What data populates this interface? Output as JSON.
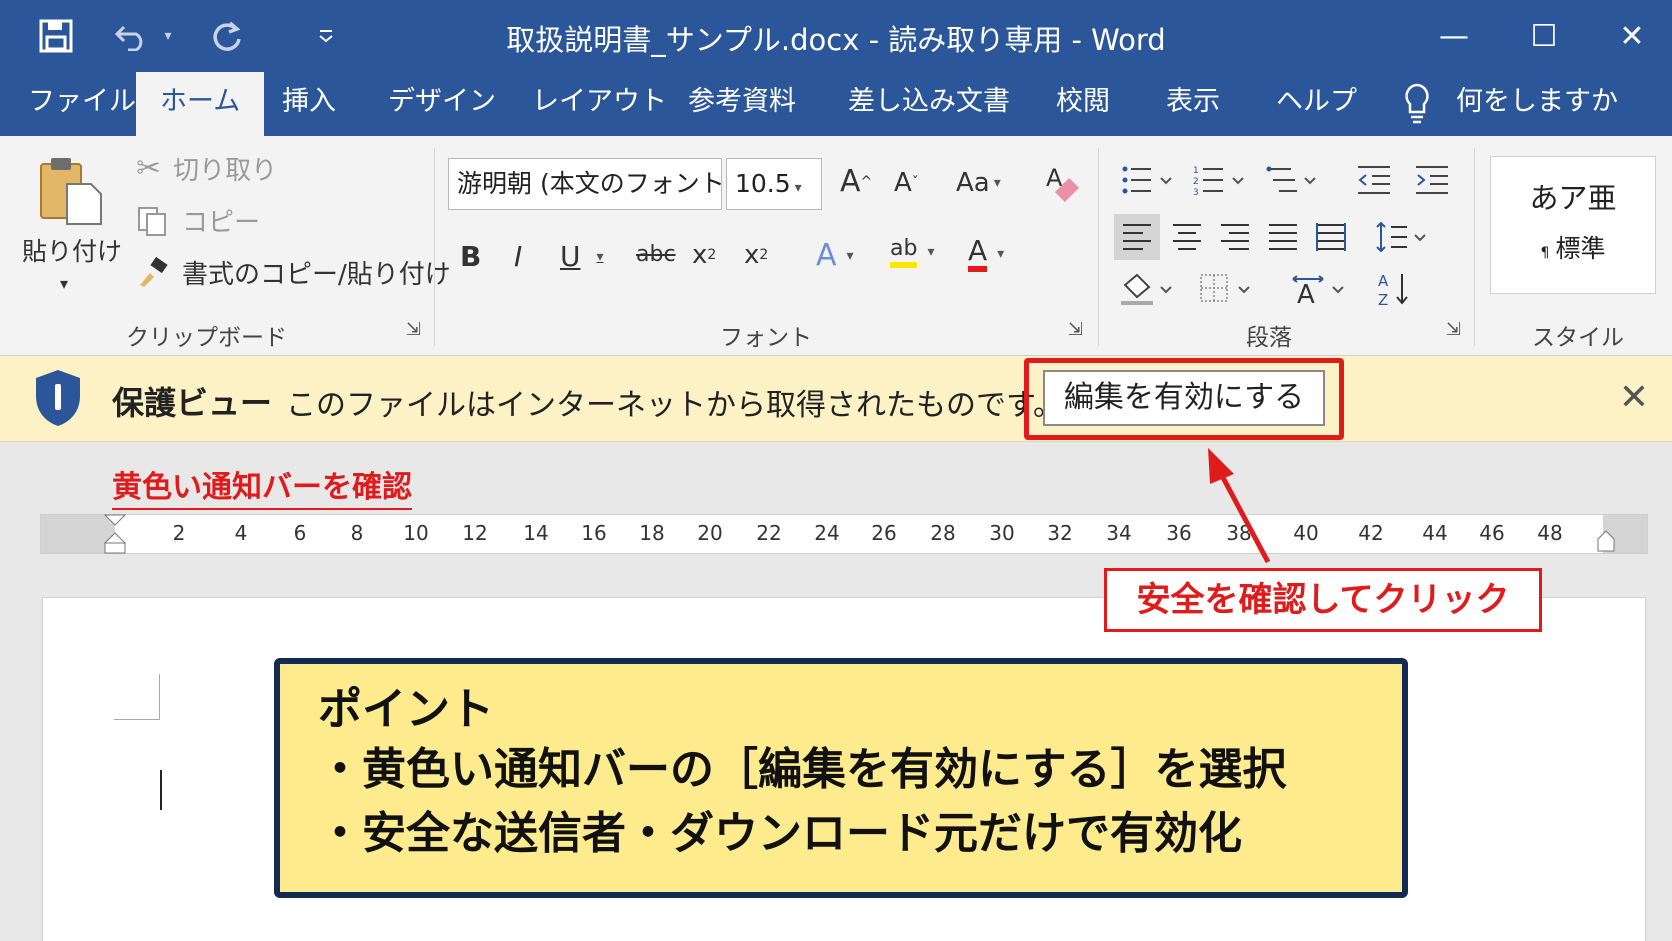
{
  "window": {
    "title": "取扱説明書_サンプル.docx - 読み取り専用 - Word",
    "minimize": "—",
    "maximize": "☐",
    "close": "✕"
  },
  "quick_access": {
    "save_icon": "floppy-disk-icon",
    "undo_icon": "undo-icon",
    "redo_icon": "redo-icon",
    "customize_icon": "chevron-down-icon"
  },
  "tabs": [
    {
      "label": "ファイル"
    },
    {
      "label": "ホーム",
      "active": true
    },
    {
      "label": "挿入"
    },
    {
      "label": "デザイン"
    },
    {
      "label": "レイアウト"
    },
    {
      "label": "参考資料"
    },
    {
      "label": "差し込み文書"
    },
    {
      "label": "校閲"
    },
    {
      "label": "表示"
    },
    {
      "label": "ヘルプ"
    }
  ],
  "tell_me": "何をしますか",
  "ribbon": {
    "clipboard": {
      "label": "クリップボード",
      "paste": "貼り付け",
      "cut": "切り取り",
      "copy": "コピー",
      "format_painter": "書式のコピー/貼り付け"
    },
    "font": {
      "label": "フォント",
      "font_name": "游明朝 (本文のフォント)",
      "font_size": "10.5",
      "grow": "A",
      "shrink": "A",
      "case": "Aa",
      "bold": "B",
      "italic": "I",
      "underline": "U",
      "strike": "abc",
      "subscript": "x",
      "superscript": "x",
      "text_effect": "A",
      "highlight": "ab",
      "font_color": "A"
    },
    "paragraph": {
      "label": "段落"
    },
    "styles": {
      "label": "スタイル",
      "preview": "あア亜",
      "name": "標準"
    }
  },
  "protected_view": {
    "title": "保護ビュー",
    "message": "このファイルはインターネットから取得されたものです。",
    "enable_button": "編集を有効にする",
    "close": "✕"
  },
  "ruler": {
    "ticks": [
      "2",
      "4",
      "6",
      "8",
      "10",
      "12",
      "14",
      "16",
      "18",
      "20",
      "22",
      "24",
      "26",
      "28",
      "30",
      "32",
      "34",
      "36",
      "38",
      "40",
      "42",
      "44",
      "46",
      "48"
    ]
  },
  "annotations": {
    "check_bar": "黄色い通知バーを確認",
    "click_safe": "安全を確認してクリック",
    "point_heading": "ポイント",
    "point_1": "・黄色い通知バーの［編集を有効にする］を選択",
    "point_2": "・安全な送信者・ダウンロード元だけで有効化"
  },
  "colors": {
    "title_bar": "#2b579a",
    "notification_bar": "#fdf2c5",
    "callout_red": "#e01b1b",
    "point_box": "#fdeb8d",
    "point_border": "#132a52"
  }
}
